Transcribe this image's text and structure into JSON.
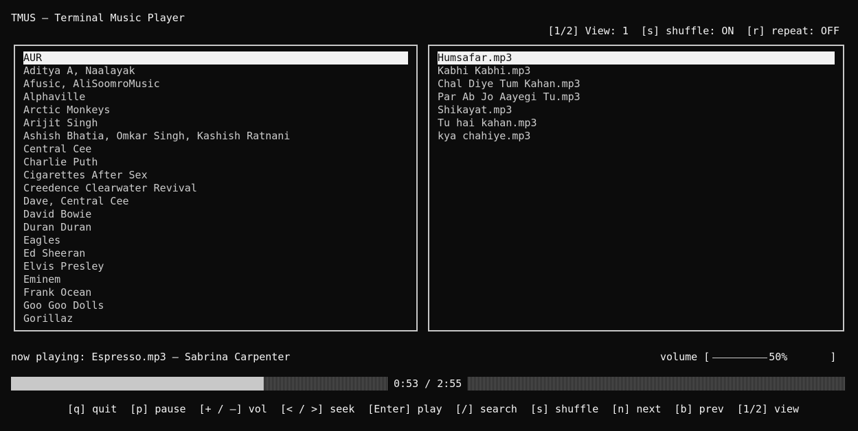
{
  "app": {
    "title": "TMUS – Terminal Music Player"
  },
  "status": {
    "view": "[1/2] View: 1",
    "shuffle": "[s] shuffle: ON",
    "repeat": "[r] repeat: OFF"
  },
  "artists": {
    "items": [
      "AUR",
      "Aditya A, Naalayak",
      "Afusic, AliSoomroMusic",
      "Alphaville",
      "Arctic Monkeys",
      "Arijit Singh",
      "Ashish Bhatia, Omkar Singh, Kashish Ratnani",
      "Central Cee",
      "Charlie Puth",
      "Cigarettes After Sex",
      "Creedence Clearwater Revival",
      "Dave, Central Cee",
      "David Bowie",
      "Duran Duran",
      "Eagles",
      "Ed Sheeran",
      "Elvis Presley",
      "Eminem",
      "Frank Ocean",
      "Goo Goo Dolls",
      "Gorillaz"
    ],
    "selected": "AUR"
  },
  "songs": {
    "items": [
      "Humsafar.mp3",
      "Kabhi Kabhi.mp3",
      "Chal Diye Tum Kahan.mp3",
      "Par Ab Jo Aayegi Tu.mp3",
      "Shikayat.mp3",
      "Tu hai kahan.mp3",
      "kya chahiye.mp3"
    ],
    "selected": "Humsafar.mp3"
  },
  "player": {
    "now_playing": "now playing: Espresso.mp3 – Sabrina Carpenter",
    "volume_label": "volume [",
    "volume_value": "50%",
    "volume_close": "]",
    "volume_level": 0.5,
    "elapsed_total": "0:53 / 2:55",
    "progress_fraction": 0.303
  },
  "keybindings": [
    "[q] quit",
    "[p] pause",
    "[+ / –] vol",
    "[< / >] seek",
    "[Enter] play",
    "[/] search",
    "[s] shuffle",
    "[n] next",
    "[b] prev",
    "[1/2] view"
  ]
}
